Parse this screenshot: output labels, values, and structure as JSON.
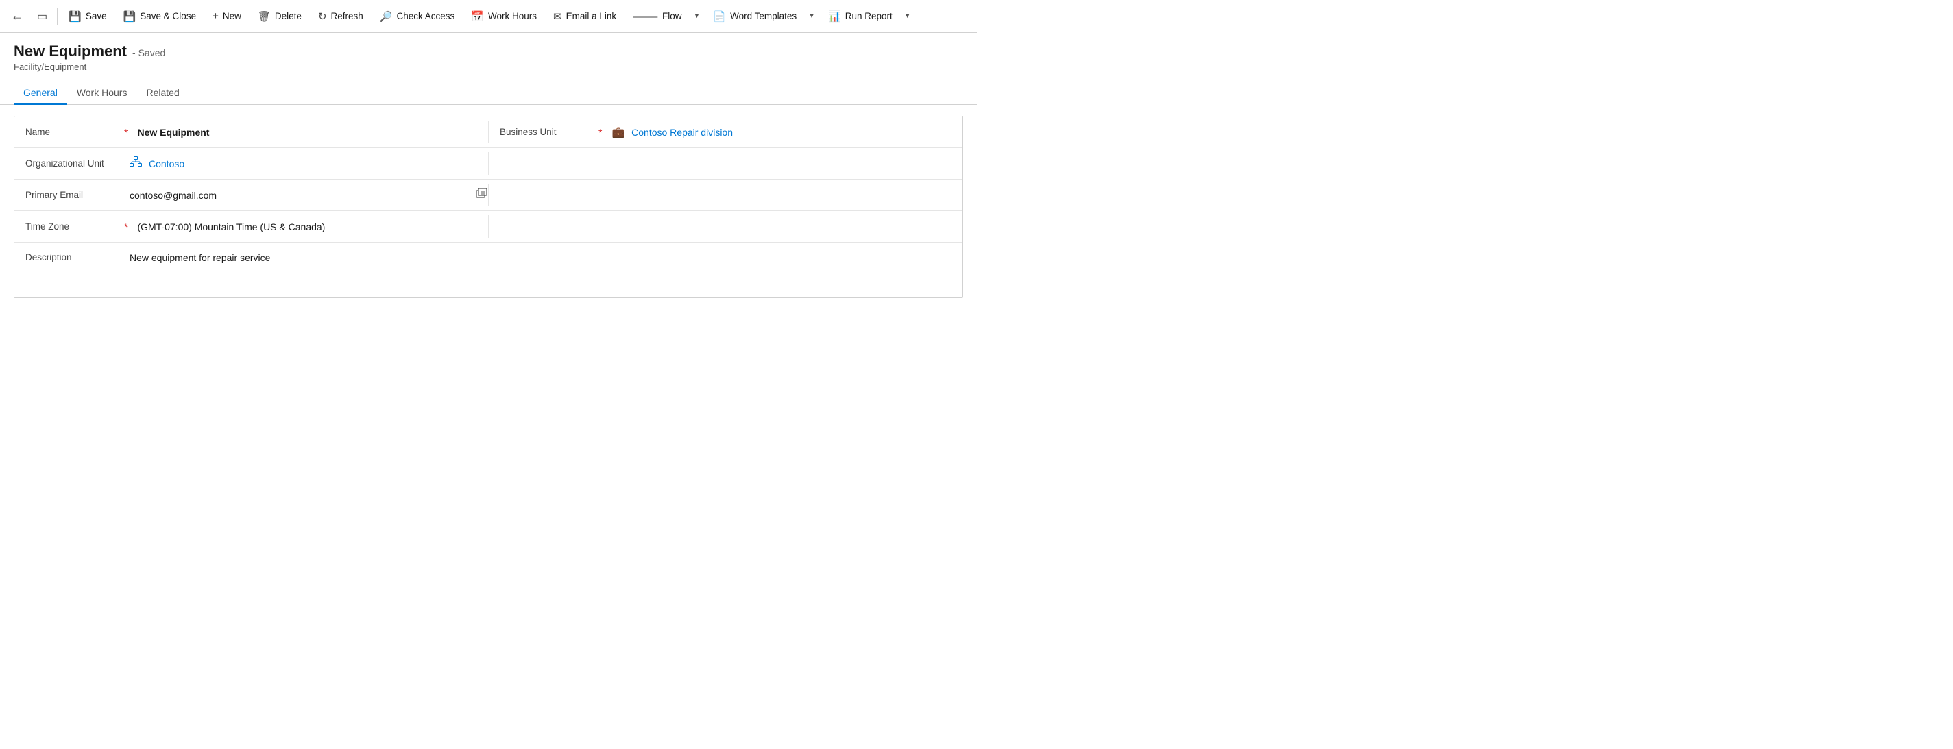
{
  "toolbar": {
    "back_label": "←",
    "window_label": "⧉",
    "save_label": "Save",
    "save_close_label": "Save & Close",
    "new_label": "New",
    "delete_label": "Delete",
    "refresh_label": "Refresh",
    "check_access_label": "Check Access",
    "work_hours_label": "Work Hours",
    "email_link_label": "Email a Link",
    "flow_label": "Flow",
    "word_templates_label": "Word Templates",
    "run_report_label": "Run Report"
  },
  "page": {
    "title": "New Equipment",
    "saved_status": "- Saved",
    "subtitle": "Facility/Equipment"
  },
  "tabs": [
    {
      "label": "General",
      "active": true
    },
    {
      "label": "Work Hours",
      "active": false
    },
    {
      "label": "Related",
      "active": false
    }
  ],
  "form": {
    "fields": [
      {
        "label": "Name",
        "required": true,
        "value": "New Equipment",
        "value_bold": true,
        "side_label": "Business Unit",
        "side_required": true,
        "side_value": "Contoso Repair division",
        "side_link": true,
        "side_icon": "biz"
      },
      {
        "label": "Organizational Unit",
        "required": false,
        "value": "Contoso",
        "link": true,
        "icon": "org",
        "side_label": "",
        "side_value": ""
      },
      {
        "label": "Primary Email",
        "required": false,
        "value": "contoso@gmail.com",
        "has_copy_icon": true,
        "side_label": "",
        "side_value": ""
      },
      {
        "label": "Time Zone",
        "required": true,
        "value": "(GMT-07:00) Mountain Time (US & Canada)",
        "side_label": "",
        "side_value": ""
      },
      {
        "label": "Description",
        "required": false,
        "value": "New equipment for repair service",
        "description": true,
        "side_label": "",
        "side_value": ""
      }
    ]
  }
}
